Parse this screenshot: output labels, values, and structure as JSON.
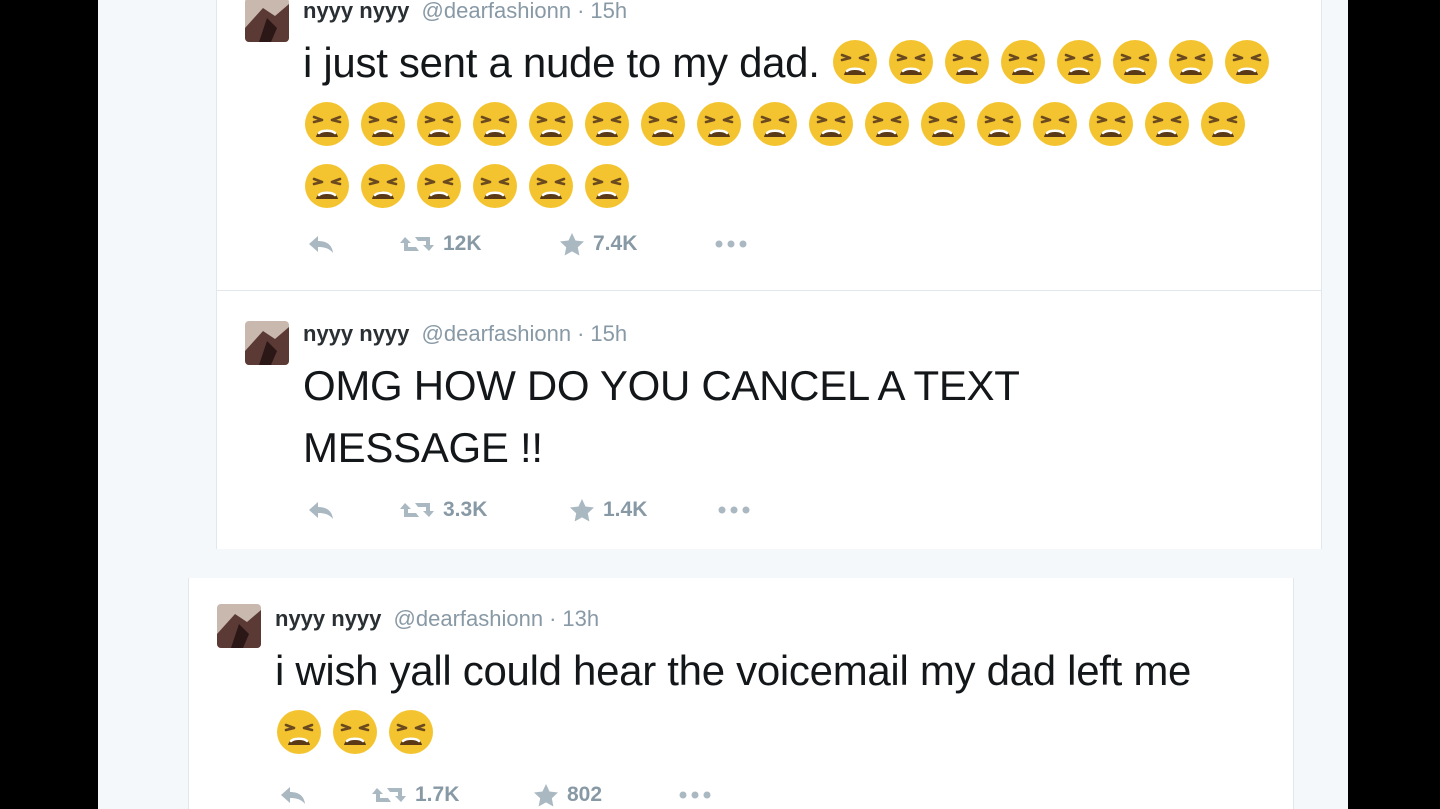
{
  "tweets": [
    {
      "fullname": "nyyy nyyy",
      "username": "@dearfashionn",
      "time": "15h",
      "text": "i just sent a nude to my dad.",
      "emoji_count": 31,
      "emoji_name": "weary-face",
      "retweets": "12K",
      "favorites": "7.4K"
    },
    {
      "fullname": "nyyy nyyy",
      "username": "@dearfashionn",
      "time": "15h",
      "text": "OMG HOW DO YOU CANCEL A TEXT MESSAGE !!",
      "emoji_count": 0,
      "retweets": "3.3K",
      "favorites": "1.4K"
    },
    {
      "fullname": "nyyy nyyy",
      "username": "@dearfashionn",
      "time": "13h",
      "text": "i wish yall could hear the voicemail my dad left me",
      "emoji_count": 3,
      "emoji_name": "weary-face",
      "retweets": "1.7K",
      "favorites": "802"
    }
  ],
  "header_separator": "·",
  "icons": {
    "reply": "reply-icon",
    "retweet": "retweet-icon",
    "favorite": "star-icon",
    "more": "more-icon"
  },
  "colors": {
    "background": "#000000",
    "timeline": "#f5f8fa",
    "card": "#ffffff",
    "text": "#14171a",
    "muted": "#8899a6",
    "emoji_face": "#f4c430"
  }
}
